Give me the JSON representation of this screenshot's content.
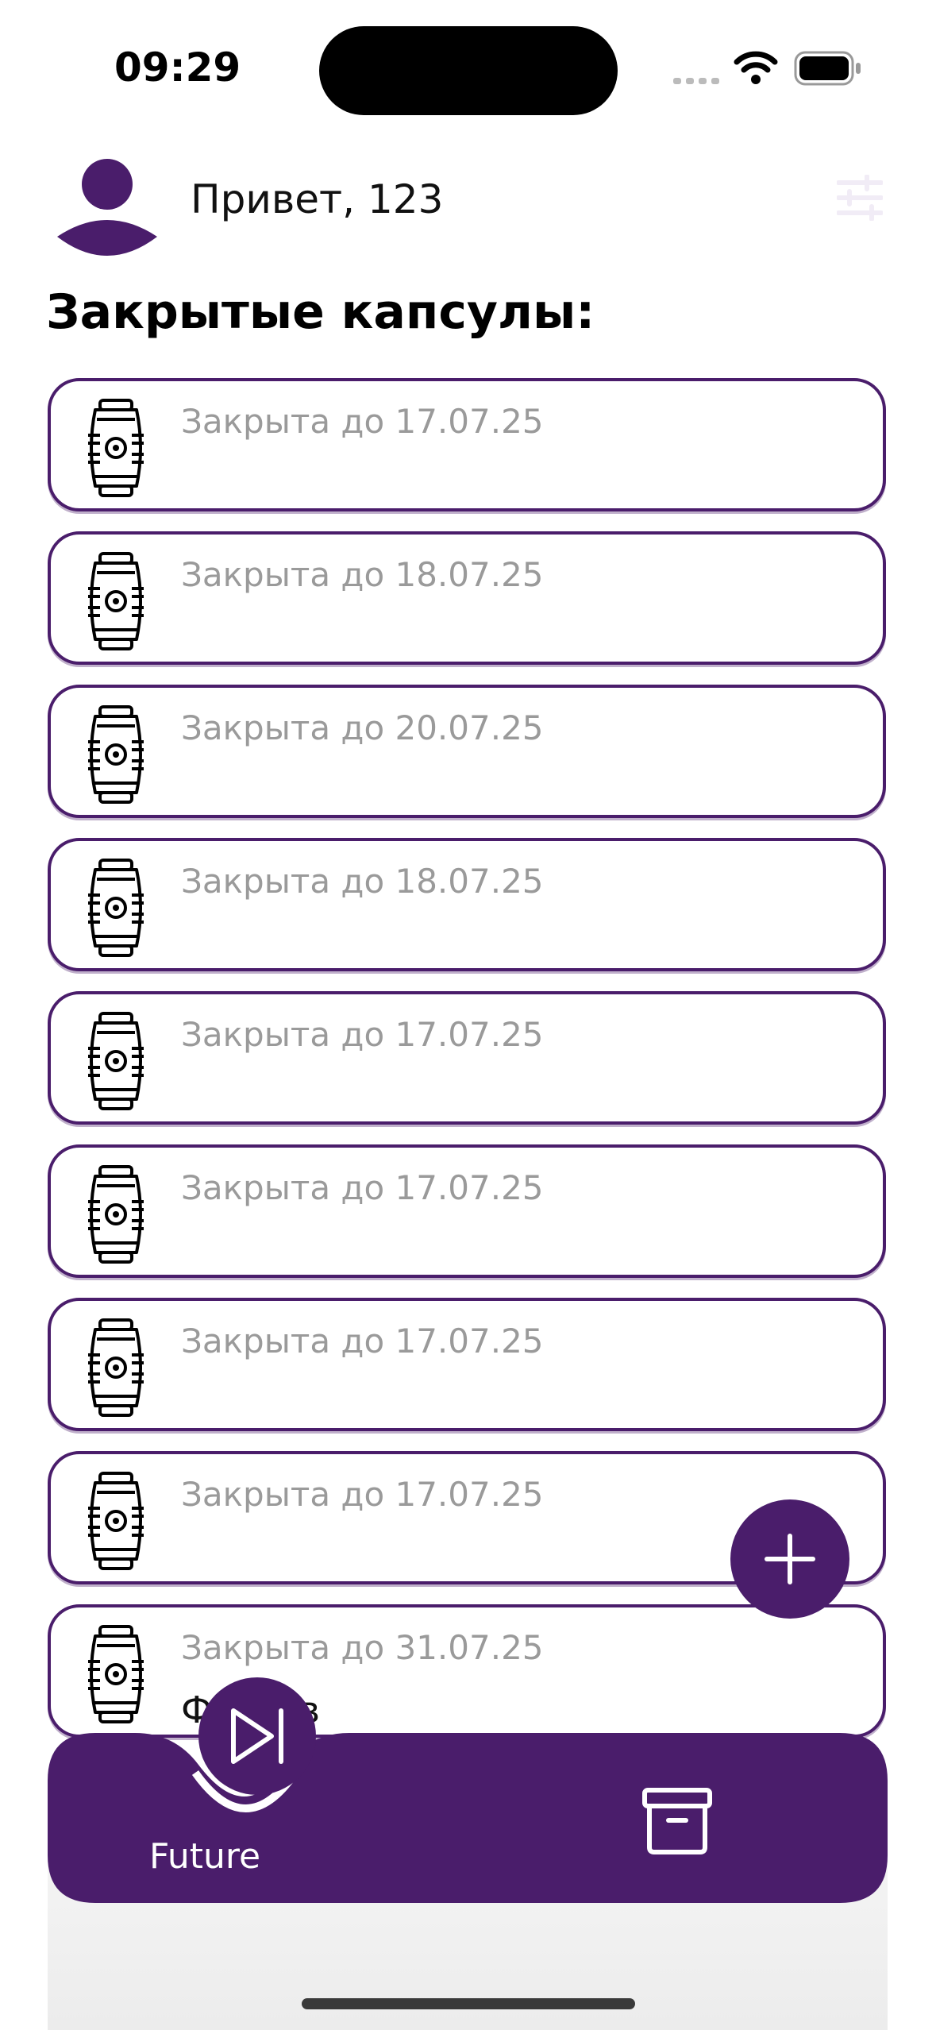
{
  "status_bar": {
    "time": "09:29"
  },
  "header": {
    "greeting": "Привет, 123"
  },
  "section": {
    "title": "Закрытые капсулы:"
  },
  "capsules": [
    {
      "date_label": "Закрыта до 17.07.25"
    },
    {
      "date_label": "Закрыта до 18.07.25"
    },
    {
      "date_label": "Закрыта до 20.07.25"
    },
    {
      "date_label": "Закрыта до 18.07.25"
    },
    {
      "date_label": "Закрыта до 17.07.25"
    },
    {
      "date_label": "Закрыта до 17.07.25"
    },
    {
      "date_label": "Закрыта до 17.07.25"
    },
    {
      "date_label": "Закрыта до 17.07.25"
    },
    {
      "date_label": "Закрыта до 31.07.25",
      "subtitle": "Фо...ыв"
    }
  ],
  "tabbar": {
    "tabs": [
      {
        "label": "Future",
        "icon": "skip-forward-icon",
        "active": true
      },
      {
        "label": "",
        "icon": "archive-icon",
        "active": false
      }
    ]
  },
  "colors": {
    "accent": "#4a1d6b",
    "date_text": "#9a9a9a"
  }
}
